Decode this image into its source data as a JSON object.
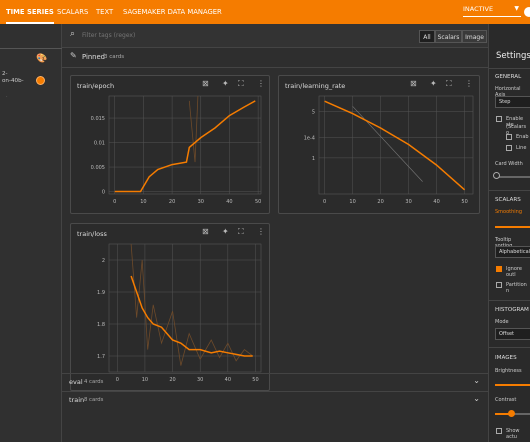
{
  "topbar": {
    "tabs": [
      "TIME SERIES",
      "SCALARS",
      "TEXT",
      "SAGEMAKER DATA MANAGER"
    ],
    "status_select": "INACTIVE"
  },
  "sidebar": {
    "run_lines": [
      "2-",
      "on-40b-"
    ]
  },
  "filter": {
    "placeholder": "Filter tags (regex)",
    "segments": [
      "All",
      "Scalars",
      "Image",
      "Histogram"
    ]
  },
  "pinned": {
    "label": "Pinned",
    "count": "3 cards"
  },
  "cards": [
    {
      "title": "train/epoch",
      "y_ticks": [
        "0.015",
        "0.01",
        "0.005",
        "0"
      ],
      "x_ticks": [
        "0",
        "10",
        "20",
        "30",
        "40",
        "50"
      ],
      "chart_data": {
        "type": "line",
        "x": [
          0,
          5,
          9,
          10,
          12,
          15,
          20,
          25,
          26,
          30,
          35,
          40,
          45,
          49
        ],
        "series": [
          {
            "values": [
              0,
              0,
              0,
              0.001,
              0.003,
              0.0045,
              0.0055,
              0.006,
              0.009,
              0.011,
              0.013,
              0.0155,
              0.0172,
              0.0185
            ]
          }
        ],
        "xlim": [
          -2,
          51
        ],
        "ylim": [
          -0.0005,
          0.0195
        ]
      }
    },
    {
      "title": "train/learning_rate",
      "y_ticks": [
        "5",
        "1e-4",
        "1"
      ],
      "x_ticks": [
        "0",
        "10",
        "20",
        "30",
        "40",
        "50"
      ],
      "chart_data": {
        "type": "line",
        "x": [
          0,
          10,
          20,
          30,
          40,
          50
        ],
        "series": [
          {
            "values": [
              1.0,
              0.88,
              0.74,
              0.58,
              0.38,
              0.14
            ]
          }
        ],
        "xlim": [
          -2,
          53
        ],
        "ylim": [
          0.1,
          1.05
        ]
      }
    },
    {
      "title": "train/loss",
      "y_ticks": [
        "2",
        "1.9",
        "1.8",
        "1.7"
      ],
      "x_ticks": [
        "0",
        "10",
        "20",
        "30",
        "40",
        "50"
      ],
      "chart_data": {
        "type": "line",
        "x": [
          5,
          7,
          9,
          11,
          13,
          16,
          20,
          23,
          26,
          30,
          34,
          37,
          40,
          43,
          46,
          49
        ],
        "series": [
          {
            "values": [
              1.95,
              1.9,
              1.85,
              1.82,
              1.8,
              1.79,
              1.75,
              1.74,
              1.72,
              1.72,
              1.71,
              1.715,
              1.71,
              1.705,
              1.7,
              1.7
            ]
          }
        ],
        "xlim": [
          -3,
          52
        ],
        "ylim": [
          1.65,
          2.05
        ]
      }
    }
  ],
  "card_icons": [
    "image-frame",
    "pin",
    "fullscreen",
    "more"
  ],
  "groups": [
    {
      "title": "eval",
      "count": "4 cards"
    },
    {
      "title": "train",
      "count": "8 cards"
    }
  ],
  "settings": {
    "title": "Settings",
    "general": "GENERAL",
    "horizontal_axis": "Horizontal Axis",
    "axis_value": "Step",
    "enable_step": "Enable ste",
    "scalars_sub": "(Scalars o",
    "enab": "Enab",
    "line": "Line",
    "card_width": "Card Width",
    "scalars": "SCALARS",
    "smoothing": "Smoothing",
    "tooltip_sorting": "Tooltip sorting",
    "sort_value": "Alphabetical",
    "ignore_outliers": "Ignore outl",
    "partition": "Partition n",
    "histograms": "HISTOGRAM",
    "mode": "Mode",
    "mode_value": "Offset",
    "images": "IMAGES",
    "brightness": "Brightness",
    "contrast": "Contrast",
    "show_actual": "Show actu"
  },
  "colors": {
    "accent": "#f57c00",
    "raw_line": "#6d4a2a"
  }
}
